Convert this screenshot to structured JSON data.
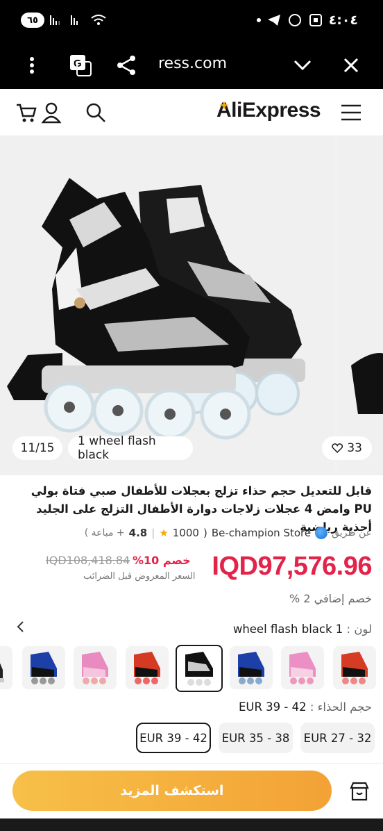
{
  "status_bar": {
    "time": "٤:٠٤",
    "battery": "٦٥"
  },
  "browser": {
    "url": "ress.com"
  },
  "header": {
    "logo": "AliExpress"
  },
  "gallery": {
    "counter": "11/15",
    "variant_label": "1 wheel flash black",
    "likes": "33"
  },
  "product": {
    "title": "قابل للتعديل حجم حذاء تزلج بعجلات للأطفال صبي فتاة بولي PU وامض 4 عجلات زلاجات دوارة الأطفال التزلج على الجليد أحذية رياضية",
    "by_label": "عن طريق",
    "store": "Be-champion Store",
    "rating": "4.8",
    "sold": "1000",
    "sold_suffix": "+ مباعة )",
    "sold_prefix": "( ",
    "price": "IQD97,576.96",
    "old_price": "IQD108,418.84",
    "discount": "خصم 10%",
    "tax_note": "السعر المعروض قبل الضرائب",
    "extra_discount": "خصم إضافي 2 %"
  },
  "color": {
    "label": "لون :",
    "value": "1 wheel flash black"
  },
  "size": {
    "label": "حجم الحذاء :",
    "value": "EUR 39 - 42",
    "options": [
      "EUR 39 - 42",
      "EUR 35 - 38",
      "EUR 27 - 32"
    ]
  },
  "cta": {
    "label": "استكشف المزيد"
  },
  "colors": {
    "price_red": "#e3234a",
    "cta_orange": "#f3a235"
  }
}
